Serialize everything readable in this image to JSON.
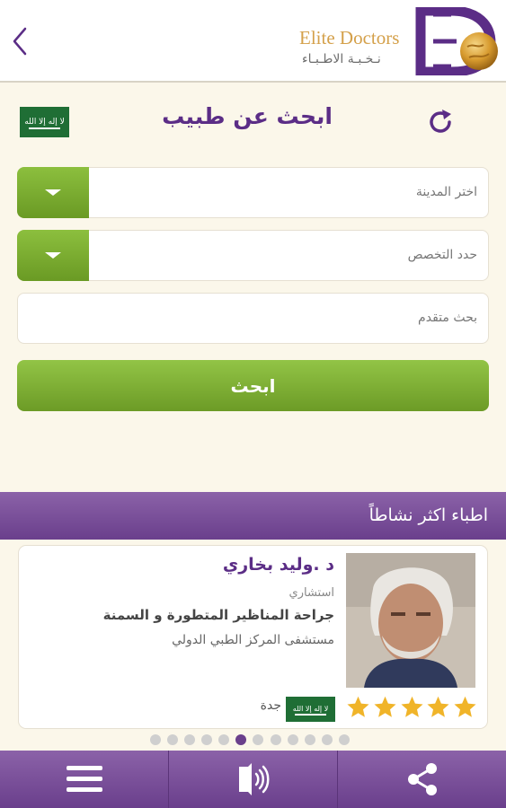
{
  "header": {
    "brand_en": "Elite Doctors",
    "brand_ar": "نـخـبـة الاطـبـاء",
    "back_icon": "chevron-left-icon",
    "logo_colors": {
      "purple": "#5b2d86",
      "gold": "#d4a04a"
    }
  },
  "search": {
    "title": "ابحث عن طبيب",
    "refresh_icon": "refresh-icon",
    "country_flag": "saudi-flag",
    "flag_script": "لا إله إلا الله",
    "city_placeholder": "اختر المدينة",
    "specialty_placeholder": "حدد التخصص",
    "advanced_placeholder": "بحث متقدم",
    "search_button": "ابحث",
    "accent": "#7aaf32"
  },
  "section": {
    "title": "اطباء اكثر نشاطاً"
  },
  "doctor": {
    "name": "د .وليد بخاري",
    "title": "استشاري",
    "specialty": "جراحة المناظير المتطورة و السمنة",
    "hospital": "مستشفى المركز الطبي الدولي",
    "city": "جدة",
    "rating": 5,
    "rating_max": 5
  },
  "pagination": {
    "count": 12,
    "active_index": 5
  },
  "bottom_bar": {
    "items": [
      {
        "icon": "menu-icon"
      },
      {
        "icon": "speaker-icon"
      },
      {
        "icon": "share-icon"
      }
    ]
  },
  "colors": {
    "purple": "#6a3f8c",
    "green": "#7aaf32",
    "background": "#fbf7ea",
    "star": "#f0b429"
  }
}
